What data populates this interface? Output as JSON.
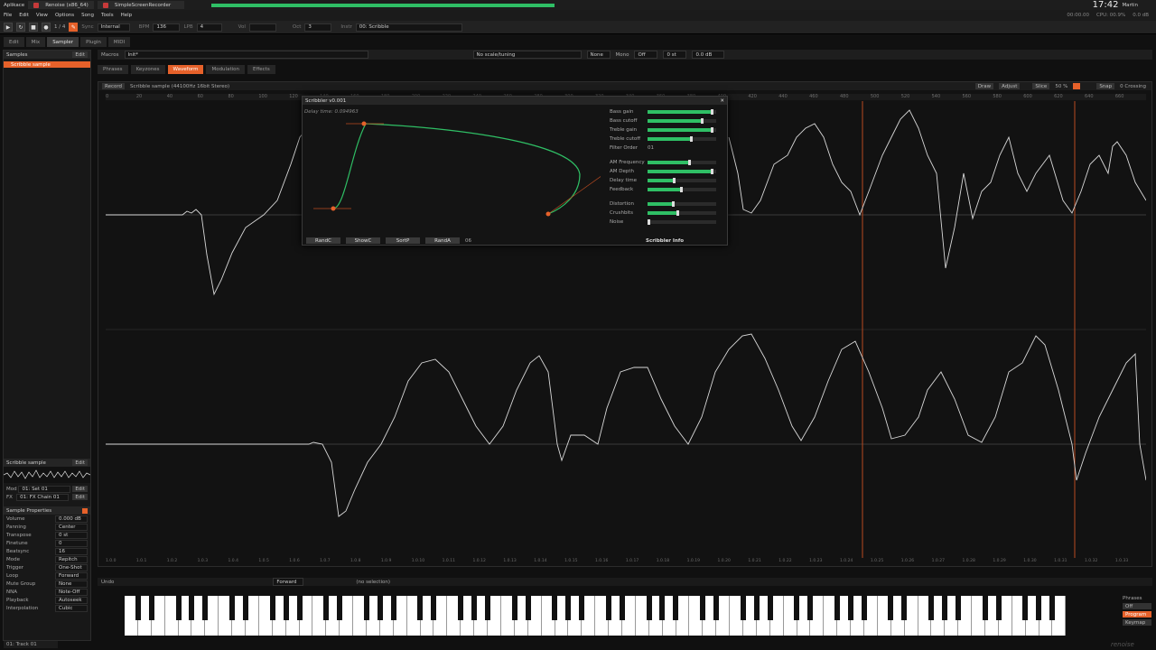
{
  "sysbar": {
    "apps": "Aplikace",
    "task1": "Renoise (x86_64)",
    "task2": "SimpleScreenRecorder",
    "clock": "17:42",
    "user": "Martin"
  },
  "menu": [
    "File",
    "Edit",
    "View",
    "Options",
    "Song",
    "Tools",
    "Help"
  ],
  "transport": {
    "pattern_step": "1 / 4",
    "sync_label": "Sync",
    "sync": "Internal",
    "bpm_label": "BPM",
    "bpm": "136",
    "lpb_label": "LPB",
    "lpb": "4",
    "vol_label": "Vol",
    "oct_label": "Oct",
    "oct": "3",
    "instr_label": "Instr",
    "instr": "00: Scribble",
    "cpu": "CPU: 00.9%",
    "time": "00:00.00",
    "db": "0.0 dB"
  },
  "tabs": {
    "edit": "Edit",
    "mix": "Mix",
    "sampler": "Sampler",
    "plugin": "Plugin",
    "midi": "MIDI"
  },
  "sampler_bar": {
    "macros": "Macros",
    "init": "Init*",
    "scale": "No scale/tuning",
    "none": "None",
    "mono": "Mono",
    "off": "Off",
    "st": "0 st",
    "db": "0.0 dB",
    "init2": "Init*"
  },
  "sub_tabs": {
    "phrases": "Phrases",
    "keyzones": "Keyzones",
    "waveform": "Waveform",
    "modulation": "Modulation",
    "effects": "Effects"
  },
  "left_panel": {
    "samples_label": "Samples",
    "edit": "Edit",
    "item": "Scribble sample",
    "preview_label": "Scribble sample",
    "mod_label": "Mod",
    "mod_value": "01: Set 01",
    "fx_label": "FX",
    "fx_value": "01: FX Chain 01",
    "props_title": "Sample Properties",
    "props": [
      {
        "k": "Volume",
        "v": "0.000 dB"
      },
      {
        "k": "Panning",
        "v": "Center"
      },
      {
        "k": "Transpose",
        "v": "0 st"
      },
      {
        "k": "Finetune",
        "v": "0"
      },
      {
        "k": "Beatsync",
        "v": "16"
      },
      {
        "k": "Mode",
        "v": "Repitch"
      },
      {
        "k": "Trigger",
        "v": "One-Shot"
      },
      {
        "k": "Loop",
        "v": "Forward"
      },
      {
        "k": "Mute Group",
        "v": "None"
      },
      {
        "k": "NNA",
        "v": "Note-Off"
      },
      {
        "k": "Playback",
        "v": "Autoseek"
      },
      {
        "k": "Interpolation",
        "v": "Cubic"
      }
    ]
  },
  "wave_header": {
    "record": "Record",
    "info": "Scribble sample (44100Hz 16bit Stereo)",
    "draw": "Draw",
    "adjust": "Adjust",
    "slice": "Slice",
    "zoom": "50 %",
    "snap": "Snap",
    "crossing": "0 Crossing"
  },
  "ruler": [
    "0",
    "20",
    "40",
    "60",
    "80",
    "100",
    "120",
    "140",
    "160",
    "180",
    "200",
    "220",
    "240",
    "260",
    "280",
    "300",
    "320",
    "340",
    "360",
    "380",
    "400",
    "420",
    "440",
    "460",
    "480",
    "500",
    "520",
    "540",
    "560",
    "580",
    "600",
    "620",
    "640",
    "660"
  ],
  "xaxis": [
    "1.0.0",
    "1.0.1",
    "1.0.2",
    "1.0.3",
    "1.0.4",
    "1.0.5",
    "1.0.6",
    "1.0.7",
    "1.0.8",
    "1.0.9",
    "1.0.10",
    "1.0.11",
    "1.0.12",
    "1.0.13",
    "1.0.14",
    "1.0.15",
    "1.0.16",
    "1.0.17",
    "1.0.18",
    "1.0.19",
    "1.0.20",
    "1.0.21",
    "1.0.22",
    "1.0.23",
    "1.0.24",
    "1.0.25",
    "1.0.26",
    "1.0.27",
    "1.0.28",
    "1.0.29",
    "1.0.30",
    "1.0.31",
    "1.0.32",
    "1.0.33"
  ],
  "dialog": {
    "title": "Scribbler v0.001",
    "delay_readout": "Delay time: 0.094963",
    "btn1": "RandC",
    "btn2": "ShowC",
    "btn3": "SortP",
    "btn4": "RandA",
    "count": "06",
    "info": "Scribbler Info",
    "sliders": [
      {
        "n": "Bass gain",
        "v": 0.95
      },
      {
        "n": "Bass cutoff",
        "v": 0.8
      },
      {
        "n": "Treble gain",
        "v": 0.95
      },
      {
        "n": "Treble cutoff",
        "v": 0.65
      },
      {
        "n": "AM Frequency",
        "v": 0.62
      },
      {
        "n": "AM Depth",
        "v": 0.95
      },
      {
        "n": "Delay time",
        "v": 0.4
      },
      {
        "n": "Feedback",
        "v": 0.5
      },
      {
        "n": "Distortion",
        "v": 0.38
      },
      {
        "n": "Crushbits",
        "v": 0.45
      },
      {
        "n": "Noise",
        "v": 0.02
      }
    ],
    "filter_label": "Filter Order",
    "filter_value": "01"
  },
  "bottom": {
    "undo": "Undo",
    "forward": "Forward",
    "selection": "(no selection)",
    "track": "01: Track 01",
    "phrases": "Phrases",
    "off": "Off",
    "program": "Program",
    "keymap": "Keymap",
    "logo": "renoise"
  },
  "accent": "#e6612a",
  "green": "#2fbf65"
}
